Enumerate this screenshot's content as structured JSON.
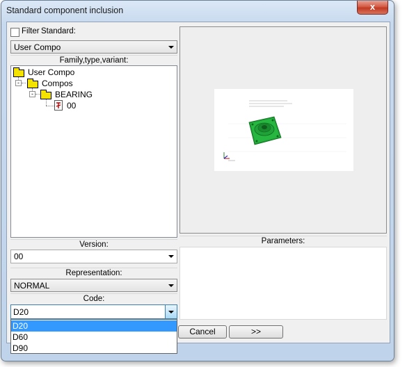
{
  "window": {
    "title": "Standard component inclusion",
    "close_glyph": "x"
  },
  "filter": {
    "checkbox_label": "Filter",
    "standard_label": "Standard:",
    "checked": false
  },
  "standard_combo": {
    "value": "User Compo"
  },
  "tree": {
    "caption": "Family,type,variant:",
    "nodes": [
      {
        "label": "User Compo",
        "icon": "folder-icon"
      },
      {
        "label": "Compos",
        "icon": "folder-icon",
        "expander": "-"
      },
      {
        "label": "BEARING",
        "icon": "folder-icon",
        "expander": "-"
      },
      {
        "label": "00",
        "icon": "part-icon"
      }
    ]
  },
  "version": {
    "caption": "Version:",
    "value": "00"
  },
  "representation": {
    "caption": "Representation:",
    "value": "NORMAL"
  },
  "code": {
    "caption": "Code:",
    "value": "D20",
    "options": [
      "D20",
      "D60",
      "D90"
    ],
    "selected_index": 0
  },
  "parameters": {
    "caption": "Parameters:"
  },
  "buttons": {
    "cancel": "Cancel",
    "next": ">>"
  },
  "colors": {
    "selection": "#3399ff",
    "folder": "#f4e300",
    "model": "#1fae3a"
  }
}
